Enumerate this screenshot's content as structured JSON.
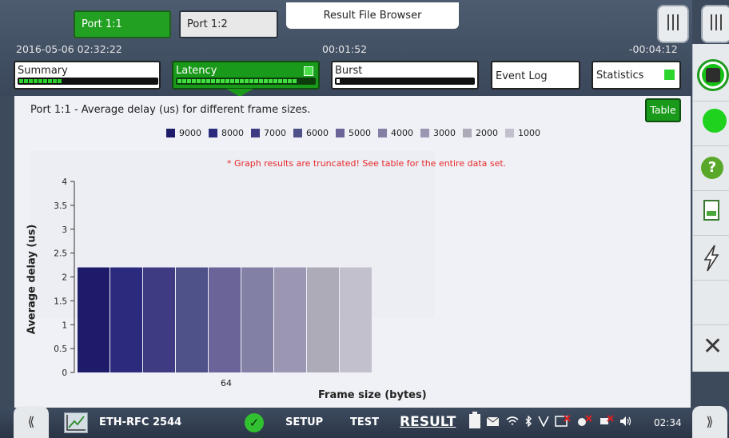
{
  "header": {
    "port_tabs": [
      "Port 1:1",
      "Port 1:2"
    ],
    "result_file_browser": "Result File Browser",
    "datetime": "2016-05-06 02:32:22",
    "elapsed": "00:01:52",
    "remaining": "-00:04:12"
  },
  "panel_tabs": {
    "summary": "Summary",
    "latency": "Latency",
    "burst": "Burst",
    "event_log": "Event Log",
    "statistics": "Statistics"
  },
  "main": {
    "title": "Port 1:1 - Average delay (us) for different frame sizes.",
    "table_button": "Table",
    "truncated_note": "* Graph results are truncated! See table for the entire data set."
  },
  "chart_data": {
    "type": "bar",
    "categories": [
      "64"
    ],
    "series": [
      {
        "name": "9000",
        "color": "#1e1c6a",
        "values": [
          2.2
        ]
      },
      {
        "name": "8000",
        "color": "#2b2a7c",
        "values": [
          2.2
        ]
      },
      {
        "name": "7000",
        "color": "#3e3b82",
        "values": [
          2.2
        ]
      },
      {
        "name": "6000",
        "color": "#4f5189",
        "values": [
          2.2
        ]
      },
      {
        "name": "5000",
        "color": "#6a6499",
        "values": [
          2.2
        ]
      },
      {
        "name": "4000",
        "color": "#8380a5",
        "values": [
          2.2
        ]
      },
      {
        "name": "3000",
        "color": "#9b97b3",
        "values": [
          2.2
        ]
      },
      {
        "name": "2000",
        "color": "#aeabb9",
        "values": [
          2.2
        ]
      },
      {
        "name": "1000",
        "color": "#c3c0cd",
        "values": [
          2.2
        ]
      }
    ],
    "xlabel": "Frame size (bytes)",
    "ylabel": "Average delay (us)",
    "yticks": [
      "4",
      "3.5",
      "3",
      "2.5",
      "2",
      "1.5",
      "1",
      "0.5",
      "0"
    ],
    "ylim": [
      0,
      4
    ]
  },
  "footer": {
    "app_name": "ETH-RFC 2544",
    "setup": "SETUP",
    "test": "TEST",
    "result": "RESULT",
    "clock": "02:34"
  },
  "icons": {
    "left_arrows": "⟪",
    "right_arrows": "⟫",
    "close": "✕",
    "help": "?",
    "check": "✓"
  }
}
